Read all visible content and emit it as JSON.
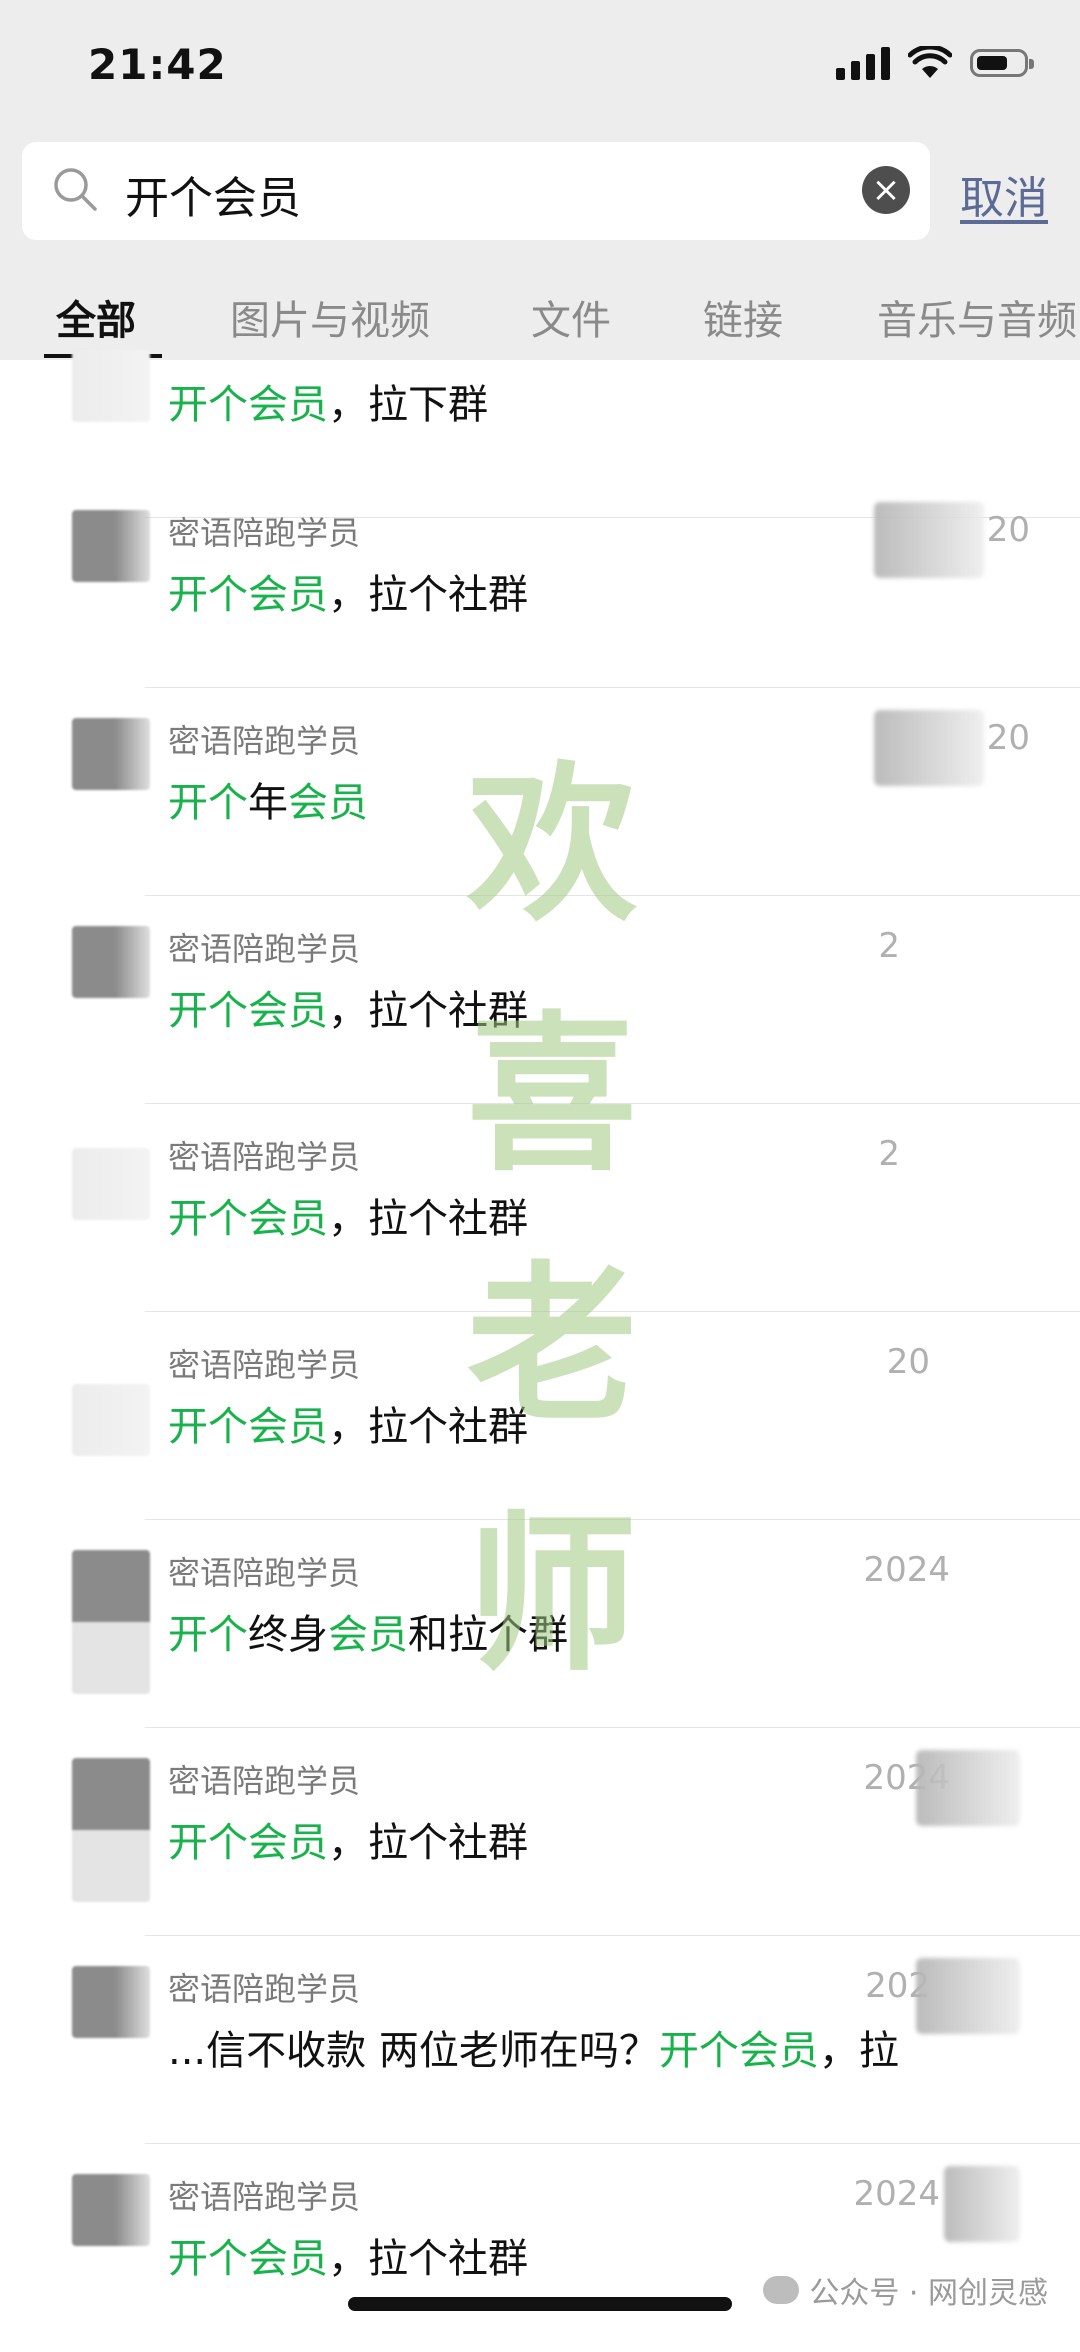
{
  "status_bar": {
    "time": "21:42"
  },
  "search": {
    "query": "开个会员",
    "cancel_label": "取消"
  },
  "tabs": [
    {
      "label": "全部"
    },
    {
      "label": "图片与视频"
    },
    {
      "label": "文件"
    },
    {
      "label": "链接"
    },
    {
      "label": "音乐与音频"
    }
  ],
  "results": [
    {
      "sender": "",
      "date": "",
      "segments": [
        {
          "t": "开个会员",
          "h": true
        },
        {
          "t": "，拉下群",
          "h": false
        }
      ]
    },
    {
      "sender": "密语陪跑学员",
      "date": "20",
      "segments": [
        {
          "t": "开个会员",
          "h": true
        },
        {
          "t": "，拉个社群",
          "h": false
        }
      ]
    },
    {
      "sender": "密语陪跑学员",
      "date": "20",
      "segments": [
        {
          "t": "开个",
          "h": true
        },
        {
          "t": "年",
          "h": false
        },
        {
          "t": "会员",
          "h": true
        }
      ]
    },
    {
      "sender": "密语陪跑学员",
      "date": "2",
      "segments": [
        {
          "t": "开个会员",
          "h": true
        },
        {
          "t": "，拉个社群",
          "h": false
        }
      ]
    },
    {
      "sender": "密语陪跑学员",
      "date": "2",
      "segments": [
        {
          "t": "开个会员",
          "h": true
        },
        {
          "t": "，拉个社群",
          "h": false
        }
      ]
    },
    {
      "sender": "密语陪跑学员",
      "date": "20",
      "segments": [
        {
          "t": "开个会员",
          "h": true
        },
        {
          "t": "，拉个社群",
          "h": false
        }
      ]
    },
    {
      "sender": "密语陪跑学员",
      "date": "2024",
      "segments": [
        {
          "t": "开个",
          "h": true
        },
        {
          "t": "终身",
          "h": false
        },
        {
          "t": "会员",
          "h": true
        },
        {
          "t": "和拉个群",
          "h": false
        }
      ]
    },
    {
      "sender": "密语陪跑学员",
      "date": "2024",
      "segments": [
        {
          "t": "开个会员",
          "h": true
        },
        {
          "t": "，拉个社群",
          "h": false
        }
      ]
    },
    {
      "sender": "密语陪跑学员",
      "date": "202",
      "segments": [
        {
          "t": "...信不收款 两位老师在吗？",
          "h": false
        },
        {
          "t": "开个会员",
          "h": true
        },
        {
          "t": "，拉",
          "h": false
        }
      ]
    },
    {
      "sender": "密语陪跑学员",
      "date": "2024",
      "segments": [
        {
          "t": "开个会员",
          "h": true
        },
        {
          "t": "，拉个社群",
          "h": false
        }
      ]
    }
  ],
  "watermark": {
    "text": "欢喜老师"
  },
  "credit": {
    "text": "公众号 · 网创灵感"
  },
  "colors": {
    "highlight": "#17b34a",
    "cancel": "#5b6b95",
    "header_bg": "#ededed"
  }
}
